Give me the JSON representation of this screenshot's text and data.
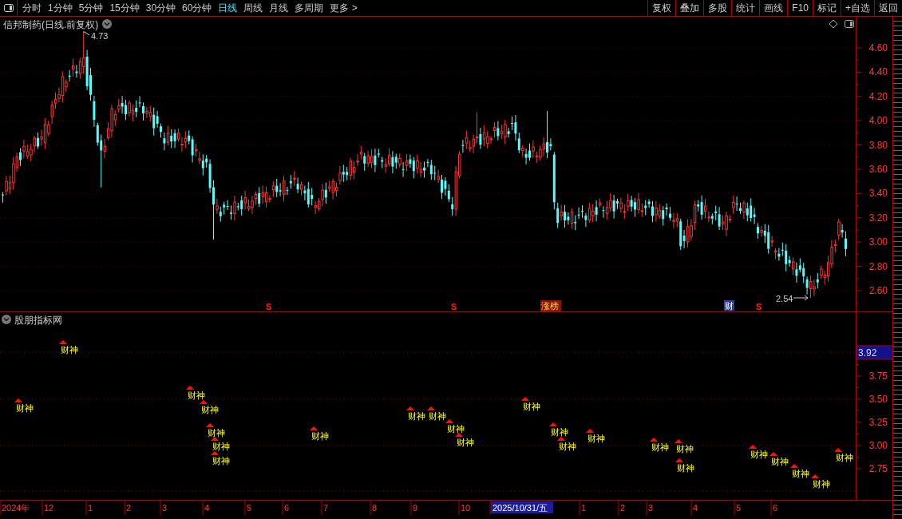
{
  "toolbar": {
    "periods": [
      {
        "label": "分时",
        "selected": false
      },
      {
        "label": "1分钟",
        "selected": false
      },
      {
        "label": "5分钟",
        "selected": false
      },
      {
        "label": "15分钟",
        "selected": false
      },
      {
        "label": "30分钟",
        "selected": false
      },
      {
        "label": "60分钟",
        "selected": false
      },
      {
        "label": "日线",
        "selected": true
      },
      {
        "label": "周线",
        "selected": false
      },
      {
        "label": "月线",
        "selected": false
      },
      {
        "label": "多周期",
        "selected": false
      },
      {
        "label": "更多 >",
        "selected": false
      }
    ],
    "actions": [
      "复权",
      "叠加",
      "多股",
      "统计",
      "画线",
      "F10",
      "标记",
      "+自选",
      "返回"
    ]
  },
  "main_chart": {
    "title": "信邦制药(日线.前复权)",
    "high_label": "4.73",
    "low_label": "2.54",
    "price_ticks": [
      "4.60",
      "4.40",
      "4.20",
      "4.00",
      "3.80",
      "3.60",
      "3.40",
      "3.20",
      "3.00",
      "2.80",
      "2.60"
    ],
    "event_marks": [
      {
        "kind": "s",
        "label": "S"
      },
      {
        "kind": "s",
        "label": "S"
      },
      {
        "kind": "tag",
        "label": "涨榜"
      },
      {
        "kind": "box",
        "label": "财"
      },
      {
        "kind": "s",
        "label": "S"
      }
    ]
  },
  "indicator": {
    "title": "股朋指标网",
    "current_value": "3.92",
    "ticks": [
      "3.75",
      "3.50",
      "3.25",
      "3.00",
      "2.75"
    ],
    "signals": [
      {
        "label": "财神"
      },
      {
        "label": "财神"
      },
      {
        "label": "财神"
      },
      {
        "label": "财神"
      },
      {
        "label": "财神"
      },
      {
        "label": "财神"
      },
      {
        "label": "财神"
      },
      {
        "label": "财神"
      },
      {
        "label": "财神"
      },
      {
        "label": "财神"
      },
      {
        "label": "财神"
      },
      {
        "label": "财神"
      },
      {
        "label": "财神"
      },
      {
        "label": "财神"
      },
      {
        "label": "财神"
      },
      {
        "label": "财神"
      },
      {
        "label": "财神"
      },
      {
        "label": "财神"
      },
      {
        "label": "财神"
      },
      {
        "label": "财神"
      },
      {
        "label": "财神"
      },
      {
        "label": "财神"
      },
      {
        "label": "财神"
      },
      {
        "label": "财神"
      }
    ]
  },
  "date_axis": {
    "labels": [
      {
        "label": "2024年",
        "selected": false
      },
      {
        "label": "12",
        "selected": false
      },
      {
        "label": "1",
        "selected": false
      },
      {
        "label": "2",
        "selected": false
      },
      {
        "label": "3",
        "selected": false
      },
      {
        "label": "4",
        "selected": false
      },
      {
        "label": "5",
        "selected": false
      },
      {
        "label": "6",
        "selected": false
      },
      {
        "label": "7",
        "selected": false
      },
      {
        "label": "8",
        "selected": false
      },
      {
        "label": "9",
        "selected": false
      },
      {
        "label": "10",
        "selected": false
      },
      {
        "label": "2025/10/31/五",
        "selected": true
      },
      {
        "label": "1",
        "selected": false
      },
      {
        "label": "2",
        "selected": false
      },
      {
        "label": "3",
        "selected": false
      },
      {
        "label": "4",
        "selected": false
      },
      {
        "label": "5",
        "selected": false
      },
      {
        "label": "6",
        "selected": false
      }
    ]
  }
}
